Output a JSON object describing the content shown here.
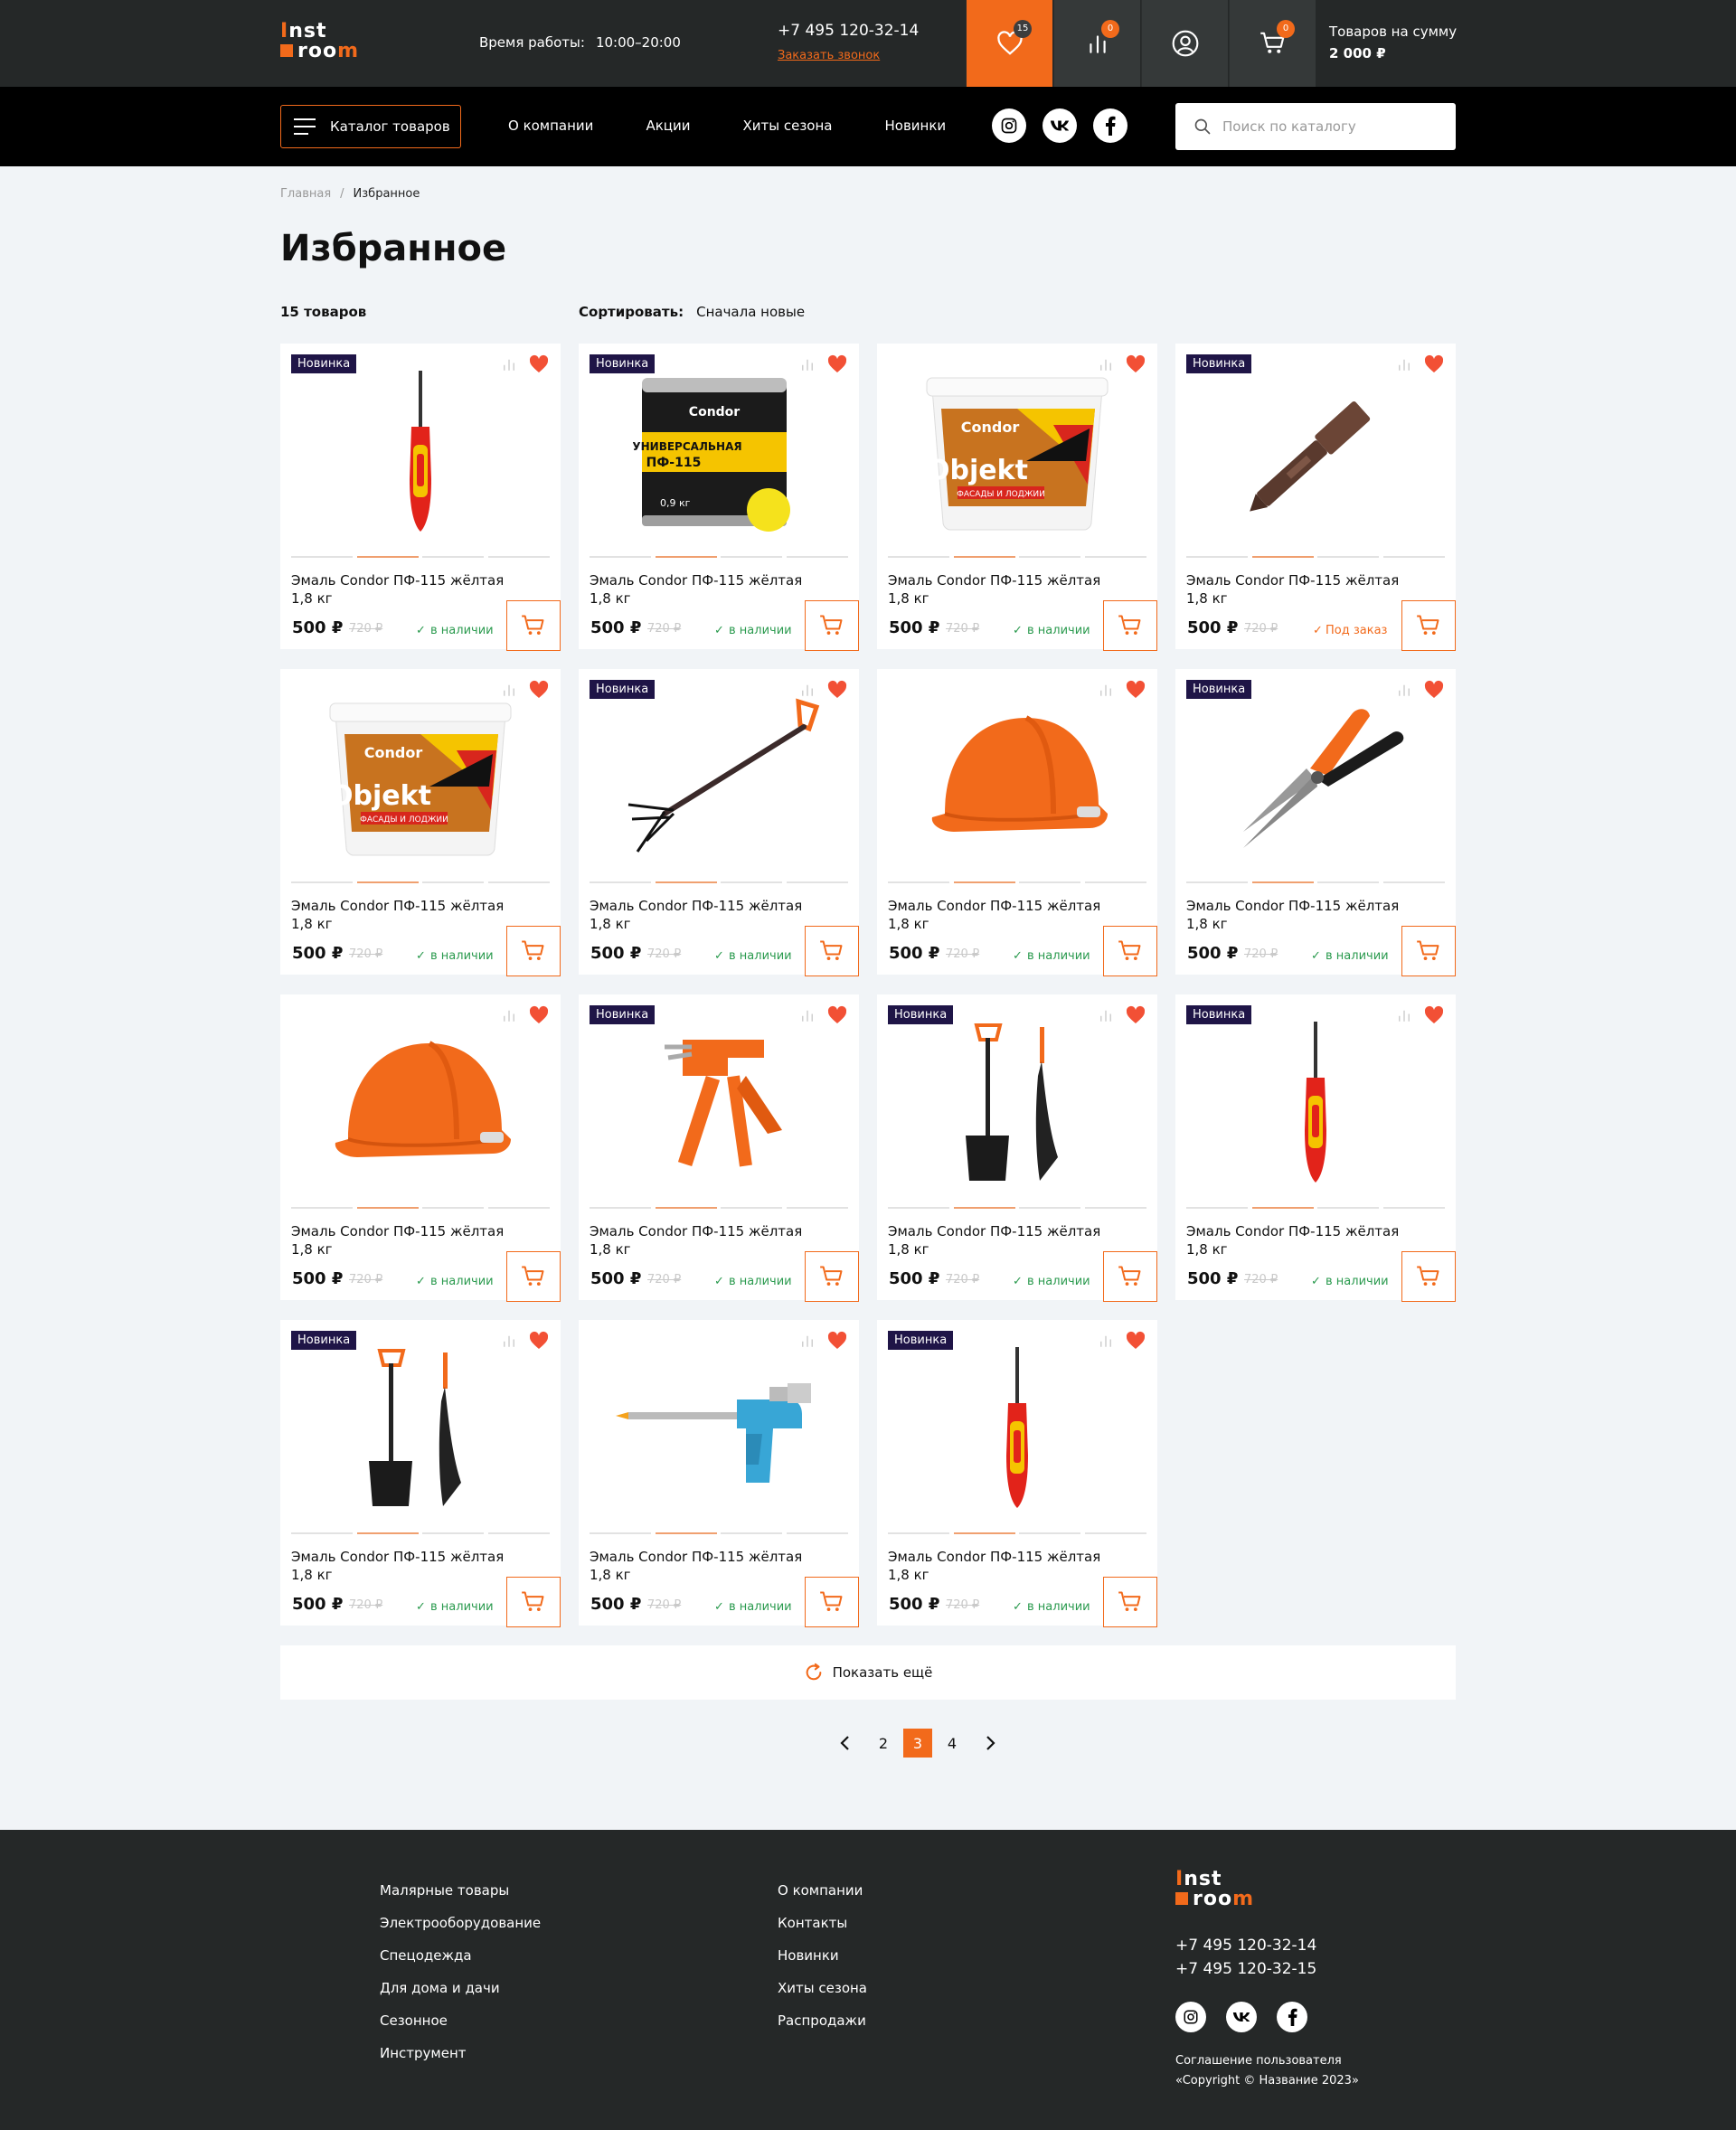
{
  "brand": {
    "line1_a": "I",
    "line1_b": "nst",
    "line2_a": "roo",
    "line2_b": "m"
  },
  "header": {
    "worktime_label": "Время работы:",
    "worktime_value": "10:00–20:00",
    "phone": "+7 495 120-32-14",
    "callback": "Заказать звонок",
    "favorites_count": "15",
    "compare_count": "0",
    "cart_count": "0",
    "cart_label": "Товаров на сумму",
    "cart_total": "2 000 ₽"
  },
  "nav": {
    "catalog": "Каталог товаров",
    "links": [
      "О компании",
      "Акции",
      "Хиты сезона",
      "Новинки"
    ],
    "search_placeholder": "Поиск по каталогу"
  },
  "socials": [
    "instagram-icon",
    "vk-icon",
    "facebook-icon"
  ],
  "breadcrumb": [
    "Главная",
    "Избранное"
  ],
  "page_title": "Избранное",
  "count": "15 товаров",
  "sort": {
    "label": "Сортировать:",
    "value": "Сначала новые"
  },
  "product_name": "Эмаль Condor ПФ-115 жёлтая",
  "product_weight": "1,8 кг",
  "products": [
    {
      "tag": "Новинка",
      "img": "screwdriver",
      "price": "500 ₽",
      "old": "720 ₽",
      "stock": "в наличии",
      "order": false,
      "dot": 1
    },
    {
      "tag": "Новинка",
      "img": "paintcan",
      "price": "500 ₽",
      "old": "720 ₽",
      "stock": "в наличии",
      "order": false,
      "dot": 1
    },
    {
      "tag": "",
      "img": "bucket",
      "price": "500 ₽",
      "old": "720 ₽",
      "stock": "в наличии",
      "order": false,
      "dot": 1
    },
    {
      "tag": "Новинка",
      "img": "bit",
      "price": "500 ₽",
      "old": "720 ₽",
      "stock": "Под заказ",
      "order": true,
      "dot": 1
    },
    {
      "tag": "",
      "img": "bucket",
      "price": "500 ₽",
      "old": "720 ₽",
      "stock": "в наличии",
      "order": false,
      "dot": 1
    },
    {
      "tag": "Новинка",
      "img": "fork",
      "price": "500 ₽",
      "old": "720 ₽",
      "stock": "в наличии",
      "order": false,
      "dot": 1
    },
    {
      "tag": "",
      "img": "helmet",
      "price": "500 ₽",
      "old": "720 ₽",
      "stock": "в наличии",
      "order": false,
      "dot": 1
    },
    {
      "tag": "Новинка",
      "img": "shears",
      "price": "500 ₽",
      "old": "720 ₽",
      "stock": "в наличии",
      "order": false,
      "dot": 1
    },
    {
      "tag": "",
      "img": "helmet",
      "price": "500 ₽",
      "old": "720 ₽",
      "stock": "в наличии",
      "order": false,
      "dot": 1
    },
    {
      "tag": "Новинка",
      "img": "gunorange",
      "price": "500 ₽",
      "old": "720 ₽",
      "stock": "в наличии",
      "order": false,
      "dot": 1
    },
    {
      "tag": "Новинка",
      "img": "shovels",
      "price": "500 ₽",
      "old": "720 ₽",
      "stock": "в наличии",
      "order": false,
      "dot": 1
    },
    {
      "tag": "Новинка",
      "img": "screwdriver",
      "price": "500 ₽",
      "old": "720 ₽",
      "stock": "в наличии",
      "order": false,
      "dot": 1
    },
    {
      "tag": "Новинка",
      "img": "shovels",
      "price": "500 ₽",
      "old": "720 ₽",
      "stock": "в наличии",
      "order": false,
      "dot": 1
    },
    {
      "tag": "",
      "img": "foamgun",
      "price": "500 ₽",
      "old": "720 ₽",
      "stock": "в наличии",
      "order": false,
      "dot": 1
    },
    {
      "tag": "Новинка",
      "img": "screwdriver",
      "price": "500 ₽",
      "old": "720 ₽",
      "stock": "в наличии",
      "order": false,
      "dot": 1
    }
  ],
  "show_more": "Показать ещё",
  "pagination": {
    "pages": [
      "2",
      "3",
      "4"
    ],
    "current": "3"
  },
  "footer": {
    "col1": [
      "Малярные товары",
      "Электрооборудование",
      "Спецодежда",
      "Для дома и дачи",
      "Сезонное",
      "Инструмент"
    ],
    "col2": [
      "О компании",
      "Контакты",
      "Новинки",
      "Хиты сезона",
      "Распродажи"
    ],
    "phone1": "+7 495 120-32-14",
    "phone2": "+7 495 120-32-15",
    "agreement": "Соглашение пользователя",
    "copyright": "«Copyright © Название 2023»"
  },
  "colors": {
    "accent": "#f26a1b",
    "dark": "#252828",
    "tag": "#1f1547",
    "in_stock": "#2a9a4e"
  }
}
